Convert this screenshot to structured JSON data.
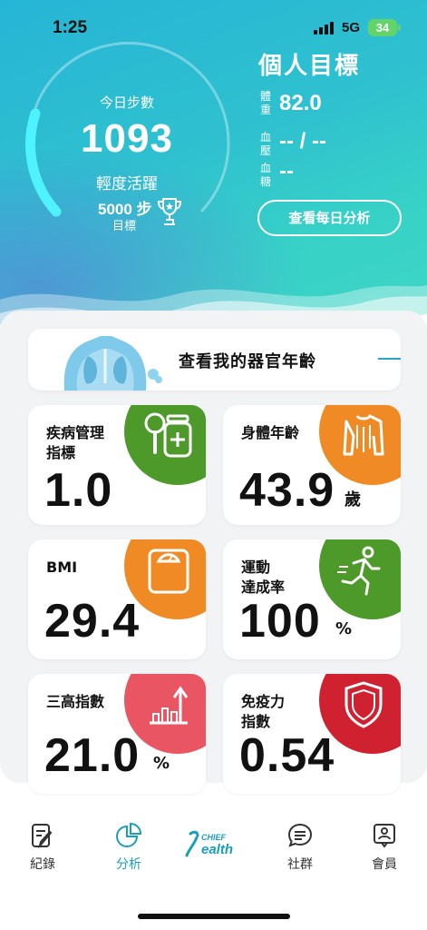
{
  "status_bar": {
    "time": "1:25",
    "network": "5G",
    "battery": "34"
  },
  "steps": {
    "label": "今日步數",
    "value": "1093",
    "activity": "輕度活躍",
    "goal_value": "5000 步",
    "goal_label": "目標"
  },
  "personal": {
    "title": "個人目標",
    "metrics": [
      {
        "label": "體重",
        "value": "82.0"
      },
      {
        "label": "血壓",
        "value": "-- / --"
      },
      {
        "label": "血糖",
        "value": "--"
      }
    ],
    "button": "查看每日分析"
  },
  "organ_banner": {
    "text": "查看我的器官年齡"
  },
  "cards": [
    {
      "title": "疾病管理\n指標",
      "value": "1.0",
      "unit": ""
    },
    {
      "title": "身體年齡",
      "value": "43.9",
      "unit": "歲"
    },
    {
      "title": "BMI",
      "value": "29.4",
      "unit": ""
    },
    {
      "title": "運動\n達成率",
      "value": "100",
      "unit": "%"
    },
    {
      "title": "三高指數",
      "value": "21.0",
      "unit": "%"
    },
    {
      "title": "免疫力\n指數",
      "value": "0.54",
      "unit": ""
    }
  ],
  "colors": {
    "green": "#4d9a2a",
    "orange": "#f08a25",
    "pink": "#e95563",
    "crimson": "#cf2130",
    "accent": "#1a9fb8"
  },
  "tabs": [
    {
      "label": "紀錄",
      "icon": "edit-note-icon",
      "active": false
    },
    {
      "label": "分析",
      "icon": "pie-chart-icon",
      "active": true
    },
    {
      "label": "社群",
      "icon": "chat-bubble-icon",
      "active": false
    },
    {
      "label": "會員",
      "icon": "member-card-icon",
      "active": false
    }
  ],
  "logo": {
    "top": "CHIEF",
    "main": "ealth"
  }
}
